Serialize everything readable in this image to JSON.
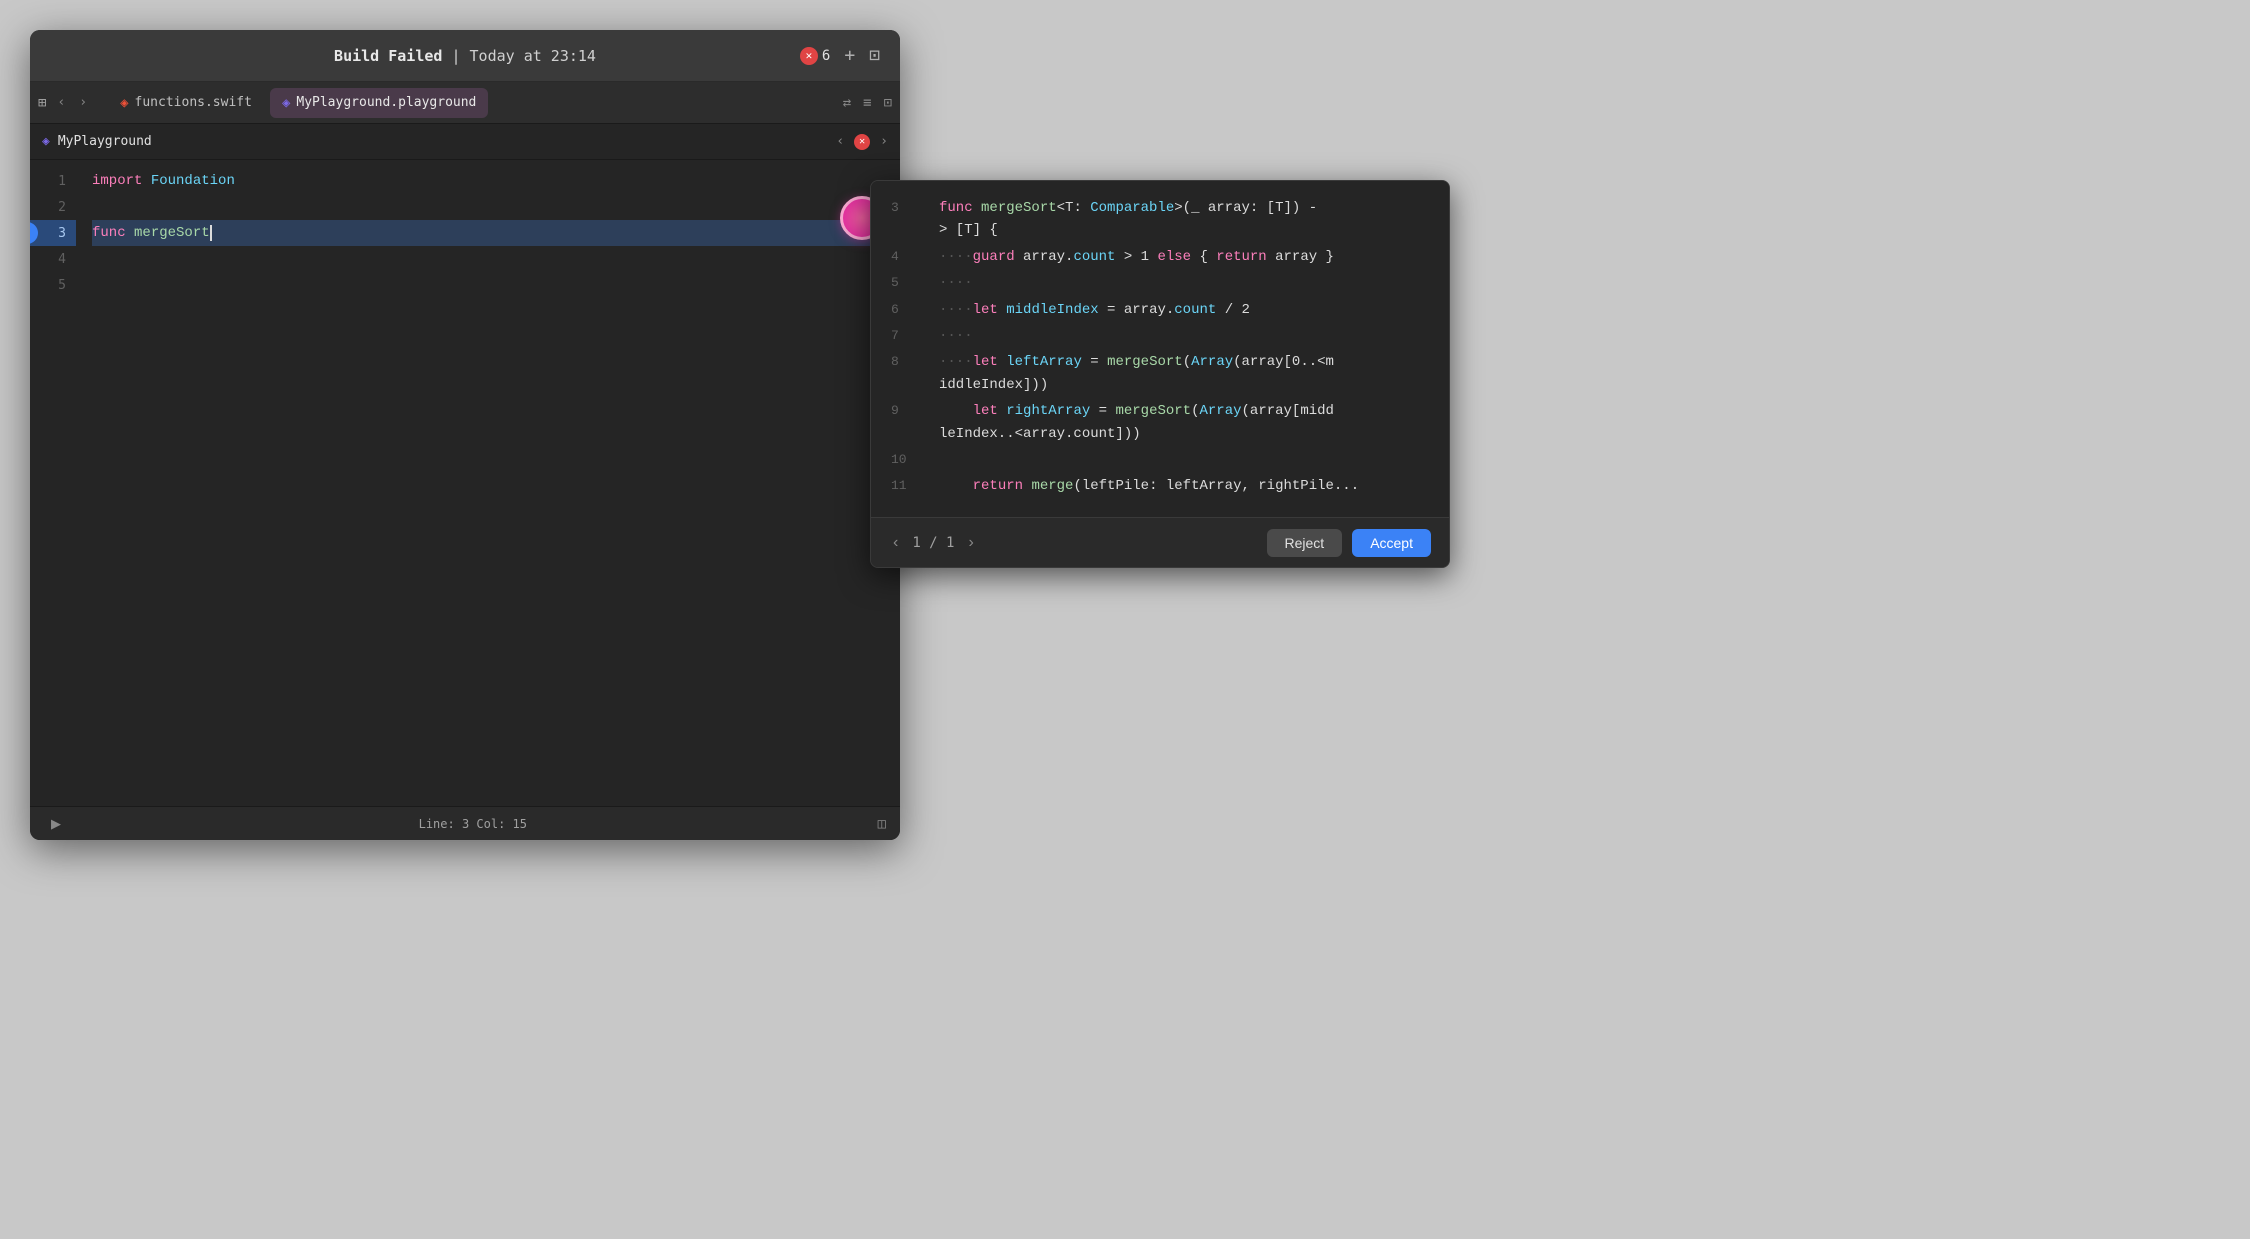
{
  "titleBar": {
    "buildStatus": "Build Failed",
    "separator": " | ",
    "timestamp": "Today at 23:14",
    "errorCount": "6",
    "addTabIcon": "+",
    "splitIcon": "⊡"
  },
  "tabBar": {
    "tabs": [
      {
        "id": "functions-swift",
        "label": "functions.swift",
        "active": false,
        "icon": "swift"
      },
      {
        "id": "myplayground",
        "label": "MyPlayground.playground",
        "active": true,
        "icon": "playground"
      }
    ],
    "gridIcon": "⊞",
    "navBack": "‹",
    "navForward": "›",
    "refreshIcon": "⇄",
    "listIcon": "≡",
    "splitIcon": "⊡"
  },
  "filePathBar": {
    "fileName": "MyPlayground",
    "navBack": "‹",
    "navForward": "›"
  },
  "editor": {
    "lines": [
      {
        "num": 1,
        "content": "import Foundation",
        "type": "import"
      },
      {
        "num": 2,
        "content": "",
        "type": "empty"
      },
      {
        "num": 3,
        "content": "func mergeSort",
        "type": "func-cursor",
        "highlighted": true
      },
      {
        "num": 4,
        "content": "",
        "type": "empty"
      },
      {
        "num": 5,
        "content": "",
        "type": "empty"
      }
    ]
  },
  "statusBar": {
    "position": "Line: 3  Col: 15",
    "runIcon": "▶",
    "settingsIcon": "◫"
  },
  "suggestion": {
    "lines": [
      {
        "num": 3,
        "content": "func mergeSort<T: Comparable>(_ array: [T]) -\n> [T] {"
      },
      {
        "num": 4,
        "content": "····guard array.count > 1 else { return array }"
      },
      {
        "num": 5,
        "content": "····"
      },
      {
        "num": 6,
        "content": "····let middleIndex = array.count / 2"
      },
      {
        "num": 7,
        "content": "····"
      },
      {
        "num": 8,
        "content": "····let leftArray = mergeSort(Array(array[0..<m\niddleIndex]))"
      },
      {
        "num": 9,
        "content": "    let rightArray = mergeSort(Array(array[midd\nleIndex..<array.count]))"
      },
      {
        "num": 10,
        "content": ""
      },
      {
        "num": 11,
        "content": "    return merge(leftPile: leftArray, rightPile..."
      }
    ],
    "pagination": "1 / 1",
    "rejectLabel": "Reject",
    "acceptLabel": "Accept"
  }
}
